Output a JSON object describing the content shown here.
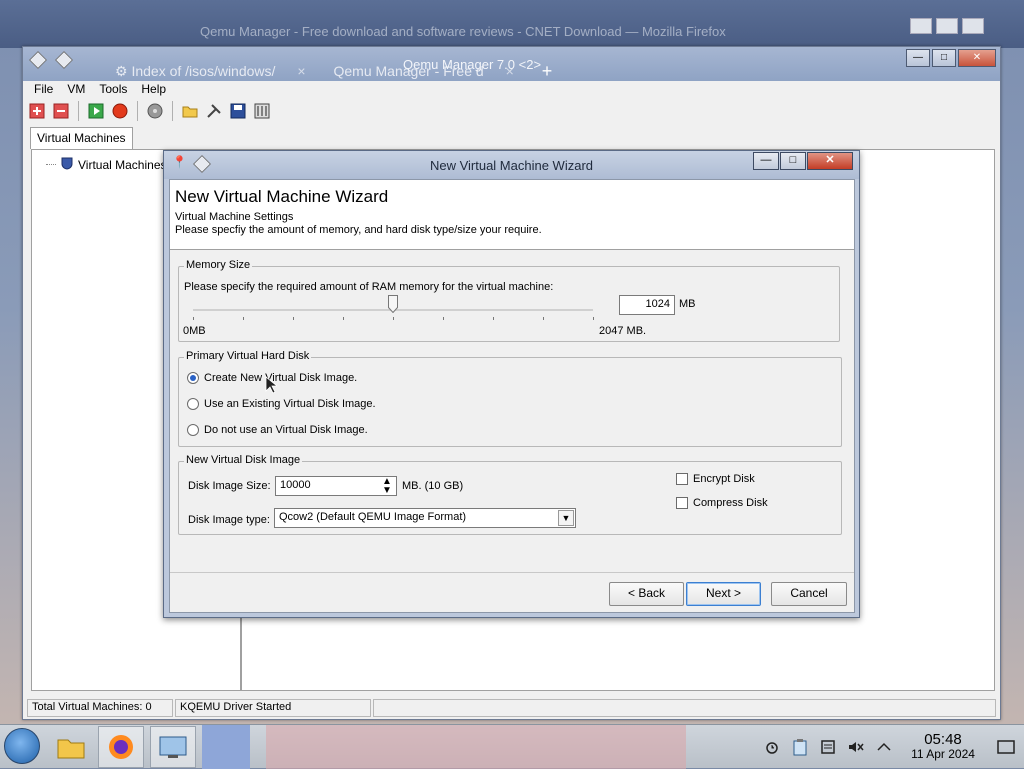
{
  "background": {
    "browser_window_title": "Qemu Manager - Free download and software reviews - CNET Download — Mozilla Firefox",
    "tabs": [
      {
        "label": "Index of /isos/windows/",
        "close": "×"
      },
      {
        "label": "Qemu Manager - Free d",
        "close": "×"
      }
    ],
    "new_tab": "+"
  },
  "main_window": {
    "title": "Qemu Manager 7.0 <2>",
    "menu": [
      "File",
      "VM",
      "Tools",
      "Help"
    ],
    "toolbar_icons": [
      "add-vm-icon",
      "delete-vm-icon",
      "start-vm-icon",
      "stop-vm-icon",
      "disk-icon",
      "open-folder-icon",
      "settings-tools-icon",
      "save-icon",
      "config-icon"
    ],
    "tab": "Virtual Machines",
    "tree_root": "Virtual Machines",
    "status": {
      "total_vms": "Total Virtual Machines: 0",
      "driver": "KQEMU Driver Started"
    }
  },
  "wizard": {
    "window_title": "New Virtual Machine Wizard",
    "header_title": "New Virtual Machine Wizard",
    "header_sub1": "Virtual Machine Settings",
    "header_sub2": "Please specfiy the amount of memory, and hard disk type/size your require.",
    "memory": {
      "group_label": "Memory Size",
      "prompt": "Please specify the required amount of RAM memory for the virtual machine:",
      "value": "1024",
      "unit": "MB",
      "min_label": "0MB",
      "max_label": "2047 MB.",
      "slider_fraction": 0.5
    },
    "hard_disk": {
      "group_label": "Primary Virtual Hard Disk",
      "options": [
        {
          "label": "Create New Virtual Disk Image.",
          "checked": true
        },
        {
          "label": "Use an  Existing Virtual Disk Image.",
          "checked": false
        },
        {
          "label": "Do not use an Virtual Disk Image.",
          "checked": false
        }
      ]
    },
    "new_disk": {
      "group_label": "New Virtual Disk Image",
      "size_label": "Disk Image Size:",
      "size_value": "10000",
      "size_unit": "MB. (10 GB)",
      "type_label": "Disk Image type:",
      "type_value": "Qcow2  (Default QEMU Image Format)",
      "encrypt_label": "Encrypt Disk",
      "compress_label": "Compress Disk",
      "encrypt_checked": false,
      "compress_checked": false
    },
    "buttons": {
      "back": "< Back",
      "next": "Next >",
      "cancel": "Cancel"
    }
  },
  "taskbar": {
    "time": "05:48",
    "date": "11 Apr 2024"
  },
  "colors": {
    "accent": "#2a62c6",
    "close_red": "#c43d26",
    "title_blue": "#aebcd4"
  }
}
